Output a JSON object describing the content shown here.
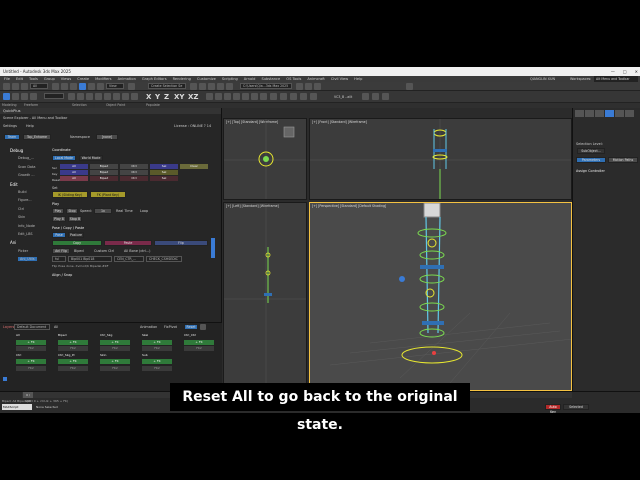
{
  "window": {
    "title": "Untitled - Autodesk 3ds Max 2025",
    "controls": [
      "—",
      "□",
      "✕"
    ]
  },
  "menu": [
    "File",
    "Edit",
    "Tools",
    "Group",
    "Views",
    "Create",
    "Modifiers",
    "Animation",
    "Graph Editors",
    "Rendering",
    "Customize",
    "Scripting",
    "Arnold",
    "Substance",
    "OS Tools",
    "Animcraft",
    "Civil View",
    "Help"
  ],
  "user": "QIANGLIN XUN",
  "workspaces_label": "Workspaces:",
  "workspace_value": "Alt Menu and Toolbar",
  "toolbar": {
    "filter_dropdown": "All",
    "view_dropdown": "View",
    "selection_set": "Create Selection Se",
    "path_field": "C:\\Users\\Qia...3ds Max 2025",
    "axis_labels": [
      "X",
      "Y",
      "Z",
      "XY",
      "XZ"
    ],
    "ik_label": "VC3_B ..ailt",
    "ribbon_labels": [
      "Modeling",
      "Freeform",
      "Selection",
      "Object Paint",
      "Populate"
    ]
  },
  "left_panel": {
    "title": "QuickPlus",
    "subtitle": "Scene Explorer - All Menu and Toolbar",
    "menu": [
      "Settings",
      "Help"
    ],
    "license": "License : ONLINE ? 14",
    "tabs": [
      "Team",
      "Top_Enhame",
      "Namespace",
      "[none]"
    ],
    "tree": [
      "Debug",
      "Debug_...",
      "Scan Data",
      "Growth ...",
      "Edit",
      "Build",
      "Figure...",
      "Ctrl",
      "Skin",
      "Info_Node",
      "Edit_LBS",
      "Ani",
      "Picker",
      "Ani_Utils"
    ],
    "coordinate_label": "Coordinate",
    "modes": [
      "Local Mode",
      "World Mode"
    ],
    "grid_headers": [
      "All",
      "Biped",
      "Ctrl",
      "Sel"
    ],
    "grid_row_labels": [
      "Sel",
      "Key",
      "Reset"
    ],
    "grid_extra": "Clear",
    "set_label": "Set",
    "set_buttons": [
      "IK (Sliding Key)",
      "FK (Plant Key)"
    ],
    "play_label": "Play",
    "play_buttons": [
      "Play",
      "Stop"
    ],
    "speed_label": "Speed:",
    "speed_value": "1x",
    "realtime_label": "Real Time",
    "loop_label": "Loop",
    "play_range": [
      "Play 8",
      "Stop B"
    ],
    "pose_label": "Pose / Copy / Paste",
    "pose_tabs": [
      "Pose",
      "Posture"
    ],
    "pose_buttons": [
      "Copy",
      "Paste",
      "Flip"
    ],
    "pose_opts": [
      "Ani Flip",
      "Biped",
      "Custom Ctrl",
      "All Bone (ctrl...)"
    ],
    "pose_fields": [
      "ful",
      "Bip001 Bip018",
      "CEN_CTR_...",
      "CHECK_CSHSEDIC"
    ],
    "pose_note": "Flip Pose done. Xvmod/K Bipedal.#RF",
    "align_label": "Align / Snap",
    "bottom_controls": {
      "layers_label": "Layers",
      "layers_value": "Default Document",
      "all_label": "All",
      "animation_label": "Animation",
      "fixpivot_label": "FixPivot",
      "reset_btn": "Reset"
    },
    "bottom_grid": [
      [
        "All",
        "Biped",
        "Ctrl_Skg",
        "Skel",
        "Ctrl_Ctrl"
      ],
      [
        "+ FK",
        "+ FK",
        "+ FK",
        "+ FK",
        "+ FK"
      ],
      [
        "FK2",
        "FK2",
        "FK2",
        "FK2",
        "FK2"
      ],
      [
        "Ctrl",
        "Ctrl_Skg_Pr",
        "Skin",
        "Sub",
        ""
      ],
      [
        "+ FK",
        "+ FK",
        "+ FK",
        "+ FK",
        ""
      ],
      [
        "FK2",
        "FK2",
        "FK2",
        "FK2",
        ""
      ]
    ]
  },
  "viewports": {
    "top": "[+] [Top] [Standard] [Wireframe]",
    "front": "[+] [Front] [Standard] [Wireframe]",
    "left": "[+] [Left] [Standard] [Wireframe]",
    "persp": "[+] [Perspective] [Standard] [Default Shading]"
  },
  "right_panel": {
    "section": "Selection Level:",
    "sub": "SubObject...",
    "tabs": [
      "Parameters",
      "Motion Paths"
    ],
    "rollout": "Assign Controller"
  },
  "status": {
    "timeline": "0 / 100",
    "prompt": "None Selected",
    "hint": "Biped: All Biped (ctrl 0 + ctrl-Ik + 365 + FK)",
    "autokey": "Auto Key",
    "selected": "Selected",
    "maxscript": "MAXScript"
  },
  "caption": "Reset All to go back to the original state."
}
